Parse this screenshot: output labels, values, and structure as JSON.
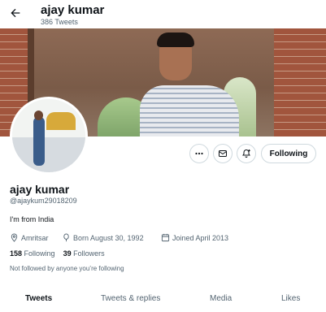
{
  "header": {
    "name": "ajay kumar",
    "tweet_count": "386 Tweets"
  },
  "profile": {
    "name": "ajay kumar",
    "handle": "@ajaykum29018209",
    "bio": "I'm from India",
    "location": "Amritsar",
    "born": "Born August 30, 1992",
    "joined": "Joined April 2013",
    "following_count": "158",
    "following_label": "Following",
    "followers_count": "39",
    "followers_label": "Followers",
    "followed_by_note": "Not followed by anyone you’re following"
  },
  "actions": {
    "following_button": "Following"
  },
  "tabs": [
    {
      "label": "Tweets"
    },
    {
      "label": "Tweets & replies"
    },
    {
      "label": "Media"
    },
    {
      "label": "Likes"
    }
  ],
  "colors": {
    "text": "#0f1419",
    "muted": "#536471",
    "border": "#cfd9de"
  }
}
